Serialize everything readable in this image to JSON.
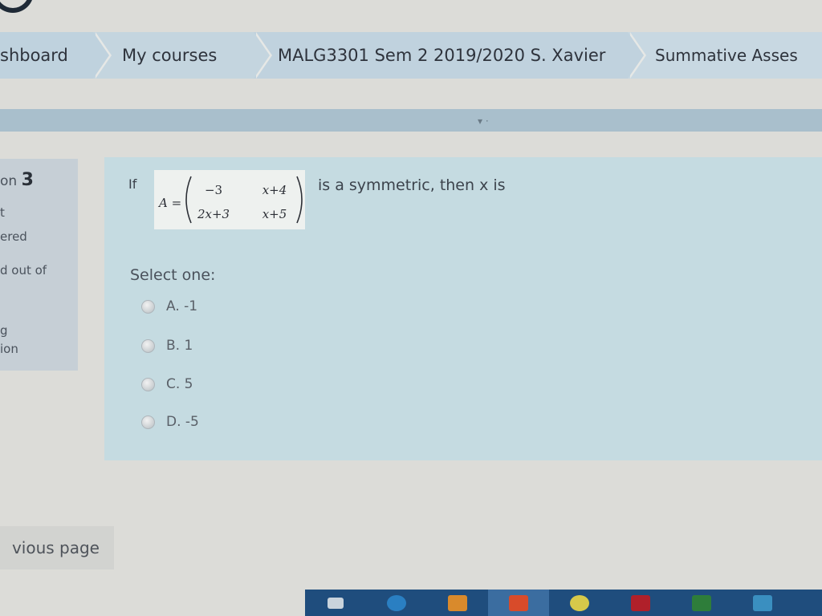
{
  "breadcrumb": [
    {
      "label": "shboard"
    },
    {
      "label": "My courses"
    },
    {
      "label": "MALG3301 Sem 2 2019/2020 S. Xavier"
    },
    {
      "label": "Summative Asses"
    }
  ],
  "question_info": {
    "number_prefix": "on",
    "number": "3",
    "line2": "t",
    "line3": "ered",
    "line4": "d out of",
    "line5": "g",
    "line6": "ion"
  },
  "question": {
    "lead": "If",
    "matrix_symbol": "A =",
    "matrix": [
      [
        "−3",
        "x+4"
      ],
      [
        "2x+3",
        "x+5"
      ]
    ],
    "tail": "is a symmetric, then x is",
    "prompt": "Select one:",
    "options": [
      {
        "label": "A. -1"
      },
      {
        "label": "B. 1"
      },
      {
        "label": "C. 5"
      },
      {
        "label": "D. -5"
      }
    ]
  },
  "navigation": {
    "prev_label": "vious page"
  },
  "taskbar": {
    "icons": [
      "task-view-icon",
      "edge-icon",
      "store-icon",
      "office-icon",
      "chrome-icon",
      "app-red-icon",
      "excel-icon",
      "mail-icon",
      "people-icon"
    ],
    "colors": [
      "#c9d3dc",
      "#2a7fc2",
      "#d98a2c",
      "#d84b2a",
      "#d7c94a",
      "#b0202a",
      "#2e7d3a",
      "#3a8fc0",
      "#e0e0e0"
    ]
  }
}
